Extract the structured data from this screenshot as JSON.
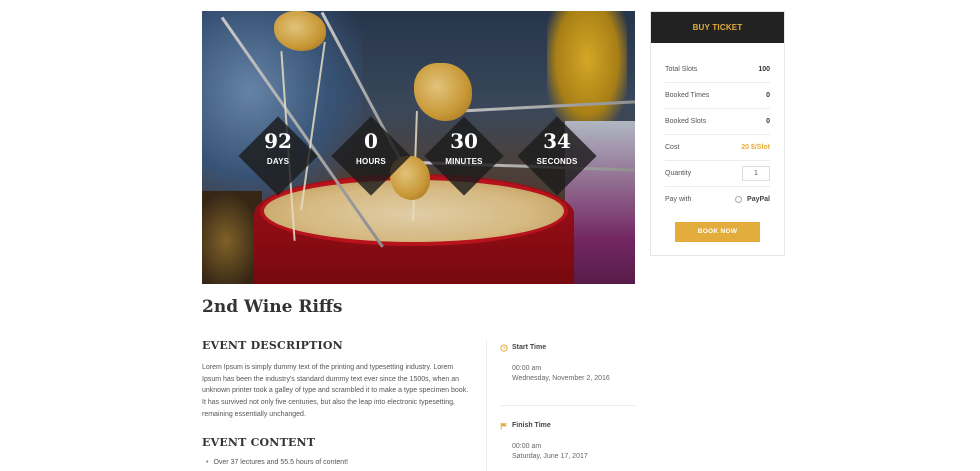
{
  "countdown": [
    {
      "value": "92",
      "label": "DAYS"
    },
    {
      "value": "0",
      "label": "HOURS"
    },
    {
      "value": "30",
      "label": "MINUTES"
    },
    {
      "value": "34",
      "label": "SECONDS"
    }
  ],
  "ticket": {
    "header": "BUY TICKET",
    "rows": {
      "total_slots": {
        "label": "Total Slots",
        "value": "100"
      },
      "booked_times": {
        "label": "Booked Times",
        "value": "0"
      },
      "booked_slots": {
        "label": "Booked Slots",
        "value": "0"
      },
      "cost": {
        "label": "Cost",
        "value": "20 $/Slot"
      },
      "quantity": {
        "label": "Quantity",
        "value": "1"
      },
      "pay_with": {
        "label": "Pay with",
        "option": "PayPal"
      }
    },
    "book_button": "BOOK NOW"
  },
  "event": {
    "title": "2nd Wine Riffs",
    "description_heading": "EVENT DESCRIPTION",
    "description": "Lorem Ipsum is simply dummy text of the printing and typesetting industry. Lorem Ipsum has been the industry's standard dummy text ever since the 1500s, when an unknown printer took a galley of type and scrambled it to make a type specimen book. It has survived not only five centuries, but also the leap into electronic typesetting, remaining essentially unchanged.",
    "content_heading": "EVENT CONTENT",
    "content_items": [
      "Over 37 lectures and 55.5 hours of content!"
    ]
  },
  "schedule": {
    "start": {
      "label": "Start Time",
      "time": "00:00 am",
      "date": "Wednesday, November 2, 2016"
    },
    "finish": {
      "label": "Finish Time",
      "time": "00:00 am",
      "date": "Saturday, June 17, 2017"
    }
  },
  "colors": {
    "accent": "#e3ad3d",
    "dark": "#222222"
  },
  "icons": {
    "start": "clock-icon",
    "finish": "flag-icon"
  }
}
